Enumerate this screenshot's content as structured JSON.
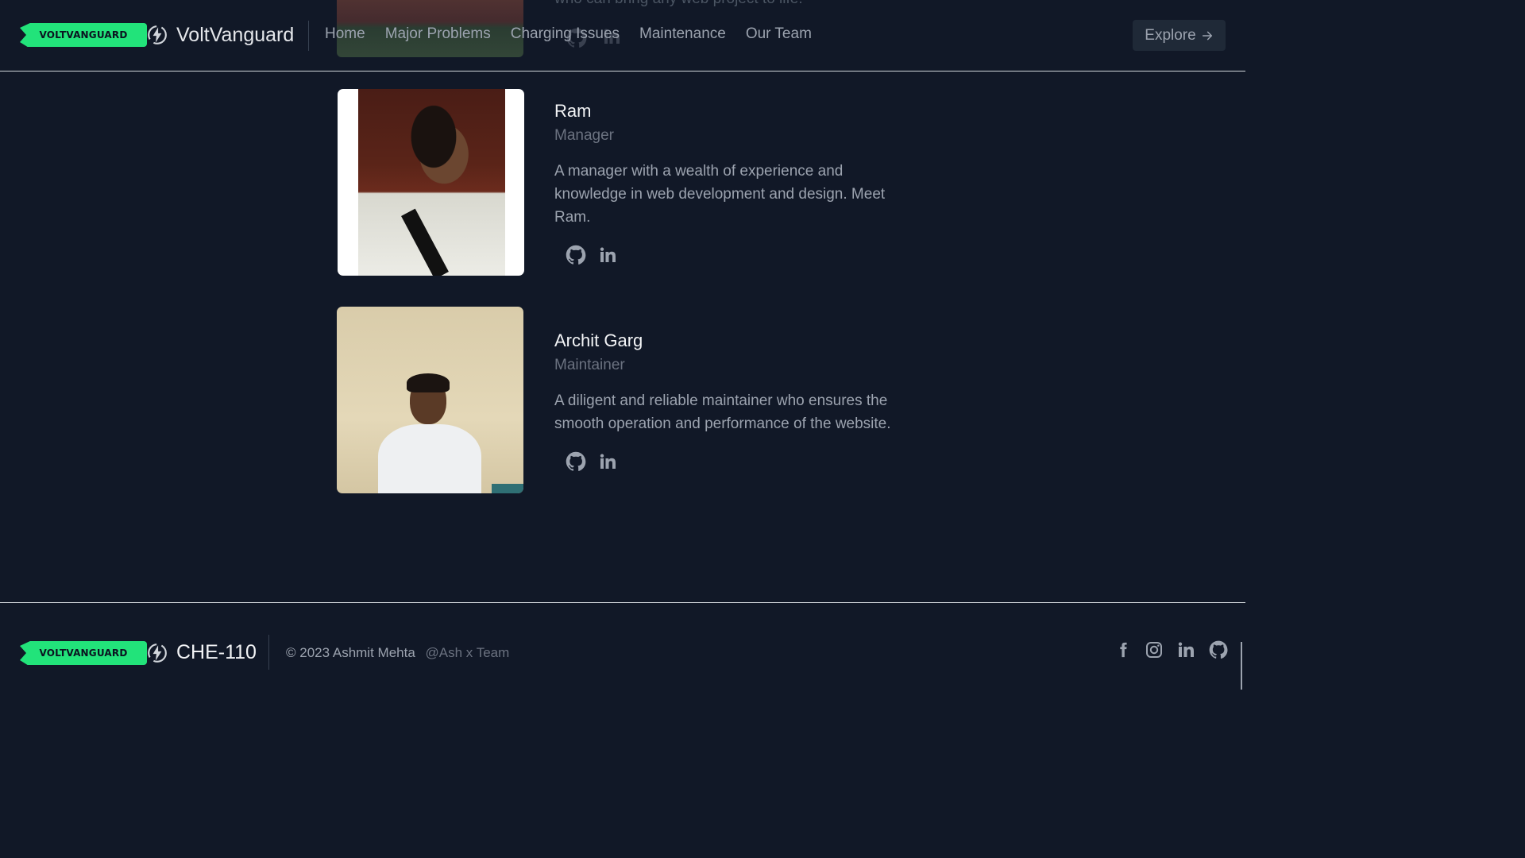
{
  "header": {
    "logo_text": "VOLTVANGUARD",
    "brand": "VoltVanguard",
    "nav": [
      "Home",
      "Major Problems",
      "Charging Issues",
      "Maintenance",
      "Our Team"
    ],
    "explore_label": "Explore",
    "explore_icon": "arrow-right-icon"
  },
  "previous_member": {
    "desc_tail": "who can bring any web project to life."
  },
  "team": [
    {
      "name": "Ram",
      "role": "Manager",
      "description": "A manager with a wealth of experience and knowledge in web development and design. Meet Ram.",
      "links": [
        "github-icon",
        "linkedin-icon"
      ]
    },
    {
      "name": "Archit Garg",
      "role": "Maintainer",
      "description": "A diligent and reliable maintainer who ensures the smooth operation and performance of the website.",
      "links": [
        "github-icon",
        "linkedin-icon"
      ]
    }
  ],
  "footer": {
    "logo_text": "VOLTVANGUARD",
    "title": "CHE-110",
    "copyright": "© 2023 Ashmit Mehta",
    "handle": "@Ash x Team",
    "socials": [
      "facebook-icon",
      "instagram-icon",
      "linkedin-icon",
      "github-icon"
    ]
  },
  "colors": {
    "background": "#111827",
    "accent": "#22e37a",
    "text_primary": "#f3f4f6",
    "text_muted": "#9ca3af"
  }
}
